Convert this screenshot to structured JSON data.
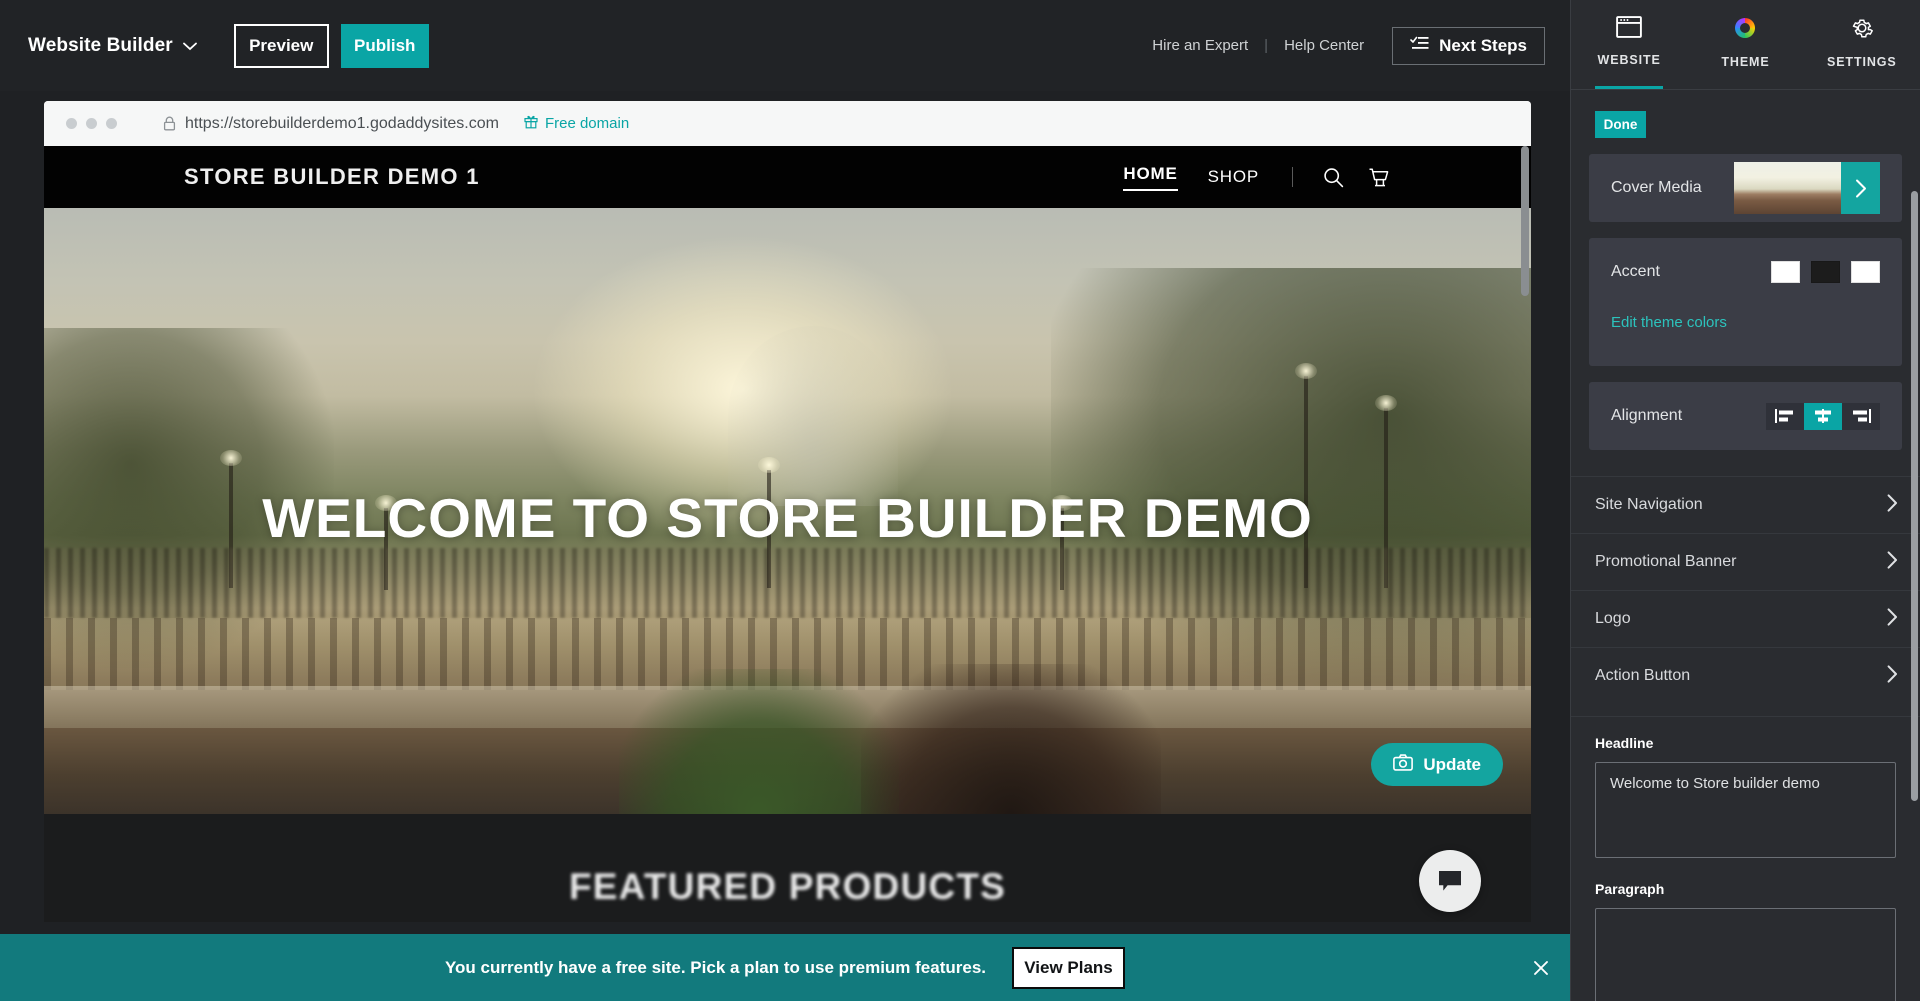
{
  "topbar": {
    "brand": "Website Builder",
    "brand_chevron_icon": "chevron-down-icon",
    "preview_label": "Preview",
    "publish_label": "Publish",
    "hire_expert_label": "Hire an Expert",
    "separator": "|",
    "help_center_label": "Help Center",
    "next_steps_label": "Next Steps",
    "next_steps_icon": "checklist-icon"
  },
  "browser": {
    "lock_icon": "lock-icon",
    "url": "https://storebuilderdemo1.godaddysites.com",
    "free_domain_icon": "gift-icon",
    "free_domain_label": "Free domain"
  },
  "site": {
    "logo": "STORE BUILDER DEMO 1",
    "nav": [
      {
        "label": "HOME",
        "active": true
      },
      {
        "label": "SHOP",
        "active": false
      }
    ],
    "search_icon": "search-icon",
    "cart_icon": "cart-icon",
    "hero_headline": "WELCOME TO STORE BUILDER DEMO",
    "update_button_label": "Update",
    "update_button_icon": "camera-icon",
    "featured_title": "FEATURED PRODUCTS",
    "chat_icon": "chat-bubble-icon"
  },
  "promo": {
    "message": "You currently have a free site. Pick a plan to use premium features.",
    "cta_label": "View Plans",
    "close_icon": "close-icon"
  },
  "panel": {
    "tabs": [
      {
        "label": "WEBSITE",
        "icon": "browser-window-icon",
        "active": true
      },
      {
        "label": "THEME",
        "icon": "color-wheel-icon",
        "active": false
      },
      {
        "label": "SETTINGS",
        "icon": "gear-icon",
        "active": false
      }
    ],
    "done_label": "Done",
    "cover_media_label": "Cover Media",
    "cover_media_arrow_icon": "chevron-right-icon",
    "accent_label": "Accent",
    "accent_swatches": [
      "#ffffff",
      "#1c1c1c",
      "#ffffff"
    ],
    "edit_theme_colors_label": "Edit theme colors",
    "alignment_label": "Alignment",
    "alignment_options": [
      {
        "name": "align-left",
        "active": false
      },
      {
        "name": "align-center",
        "active": true
      },
      {
        "name": "align-right",
        "active": false
      }
    ],
    "sections": [
      {
        "label": "Site Navigation",
        "icon": "chevron-right-icon"
      },
      {
        "label": "Promotional Banner",
        "icon": "chevron-right-icon"
      },
      {
        "label": "Logo",
        "icon": "chevron-right-icon"
      },
      {
        "label": "Action Button",
        "icon": "chevron-right-icon"
      }
    ],
    "headline_label": "Headline",
    "headline_value": "Welcome to Store builder demo",
    "paragraph_label": "Paragraph",
    "paragraph_value": ""
  },
  "colors": {
    "accent_teal": "#0aa5a5",
    "panel_bg": "#2a2c30",
    "card_bg": "#3b3d46",
    "topbar_bg": "#212326",
    "promo_bg": "#127a7d"
  }
}
